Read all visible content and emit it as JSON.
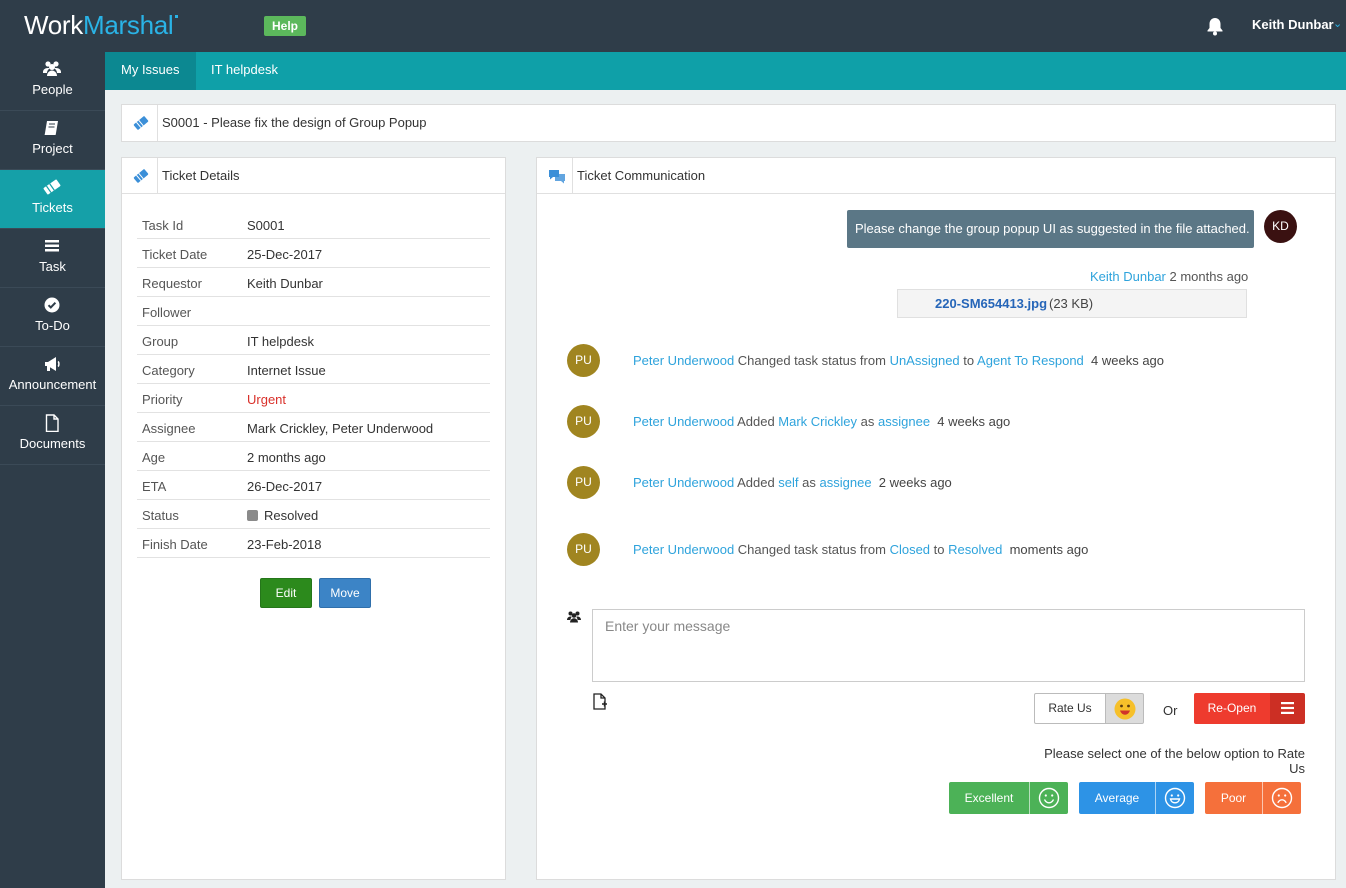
{
  "app": {
    "logo_work": "Work",
    "logo_marshal": "Marshal",
    "help_label": "Help",
    "user_name": "Keith Dunbar"
  },
  "sidebar": {
    "items": [
      {
        "label": "People",
        "icon": "people-icon"
      },
      {
        "label": "Project",
        "icon": "book-icon"
      },
      {
        "label": "Tickets",
        "icon": "ticket-icon",
        "active": true
      },
      {
        "label": "Task",
        "icon": "list-icon"
      },
      {
        "label": "To-Do",
        "icon": "check-circle-icon"
      },
      {
        "label": "Announcement",
        "icon": "megaphone-icon"
      },
      {
        "label": "Documents",
        "icon": "document-icon"
      }
    ]
  },
  "tabs": [
    {
      "label": "My Issues",
      "active": true
    },
    {
      "label": "IT helpdesk",
      "active": false
    }
  ],
  "ticket_title": "S0001 - Please fix the design of Group Popup",
  "details": {
    "title": "Ticket Details",
    "rows": [
      {
        "key": "Task Id",
        "value": "S0001"
      },
      {
        "key": "Ticket Date",
        "value": "25-Dec-2017"
      },
      {
        "key": "Requestor",
        "value": "Keith Dunbar"
      },
      {
        "key": "Follower",
        "value": ""
      },
      {
        "key": "Group",
        "value": "IT helpdesk"
      },
      {
        "key": "Category",
        "value": "Internet Issue"
      },
      {
        "key": "Priority",
        "value": "Urgent"
      },
      {
        "key": "Assignee",
        "value": "Mark Crickley, Peter Underwood"
      },
      {
        "key": "Age",
        "value": "2 months ago"
      },
      {
        "key": "ETA",
        "value": "26-Dec-2017"
      },
      {
        "key": "Status",
        "value": "Resolved"
      },
      {
        "key": "Finish Date",
        "value": "23-Feb-2018"
      }
    ],
    "edit_label": "Edit",
    "move_label": "Move",
    "priority_color": "#d9302a"
  },
  "communication": {
    "title": "Ticket Communication",
    "message": {
      "text": "Please change the group popup UI as suggested in the file attached.",
      "avatar": "KD",
      "author": "Keith Dunbar",
      "time": "2 months ago",
      "attachment_name": "220-SM654413.jpg",
      "attachment_size": "(23 KB)"
    },
    "activities": [
      {
        "avatar": "PU",
        "actor": "Peter Underwood",
        "p1": "Changed task status from",
        "l1": "UnAssigned",
        "p2": "to",
        "l2": "Agent To Respond",
        "time": "4 weeks ago"
      },
      {
        "avatar": "PU",
        "actor": "Peter Underwood",
        "p1": "Added",
        "l1": "Mark Crickley",
        "p2": "as",
        "l2": "assignee",
        "time": "4 weeks ago"
      },
      {
        "avatar": "PU",
        "actor": "Peter Underwood",
        "p1": "Added",
        "l1": "self",
        "p2": "as",
        "l2": "assignee",
        "time": "2 weeks ago"
      },
      {
        "avatar": "PU",
        "actor": "Peter Underwood",
        "p1": "Changed task status from",
        "l1": "Closed",
        "p2": "to",
        "l2": "Resolved",
        "time": "moments ago"
      }
    ],
    "input_placeholder": "Enter your message",
    "rate_us_label": "Rate Us",
    "or_label": "Or",
    "reopen_label": "Re-Open",
    "rate_prompt": "Please select one of the below option to Rate Us",
    "ratings": [
      {
        "label": "Excellent",
        "color": "#4cb257"
      },
      {
        "label": "Average",
        "color": "#2d93e6"
      },
      {
        "label": "Poor",
        "color": "#f5703b"
      }
    ]
  }
}
